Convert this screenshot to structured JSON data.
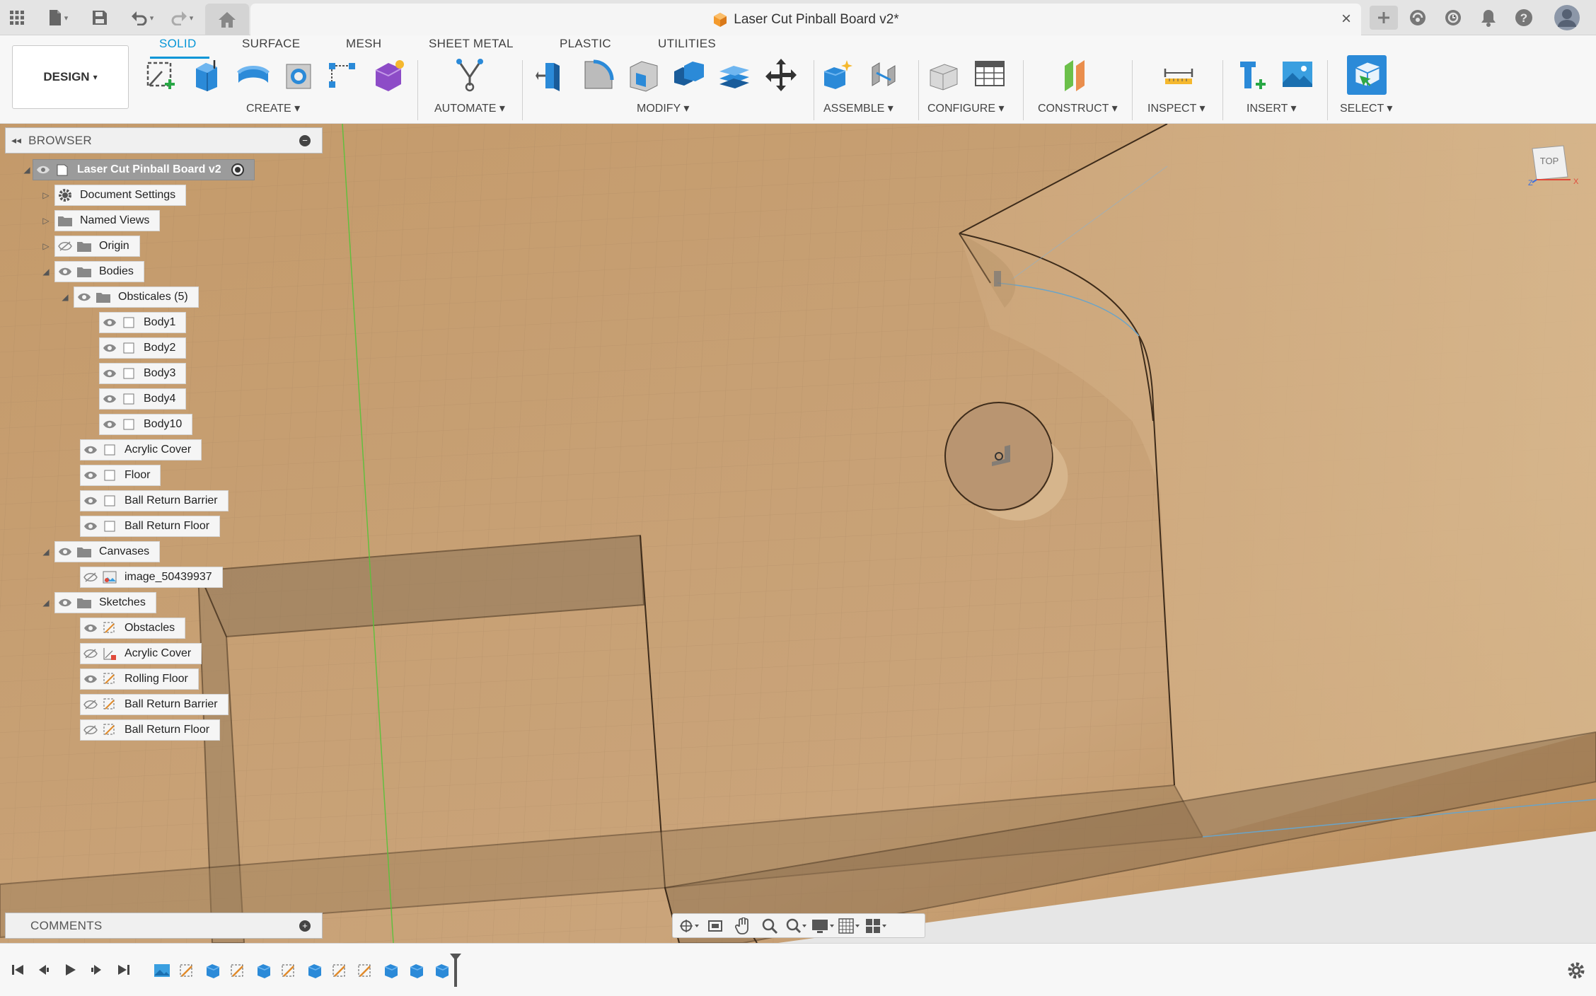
{
  "app": {
    "title": "Laser Cut Pinball Board v2*",
    "close_symbol": "×",
    "icons": [
      "apps-grid-icon",
      "file-icon",
      "save-icon",
      "undo-icon",
      "redo-icon",
      "home-icon",
      "new-tab-icon",
      "extensions-icon",
      "job-status-icon",
      "notification-icon",
      "help-icon",
      "user-avatar-icon"
    ]
  },
  "workspace": {
    "label": "DESIGN",
    "caret": "▾"
  },
  "tabs": [
    {
      "label": "SOLID",
      "active": true
    },
    {
      "label": "SURFACE"
    },
    {
      "label": "MESH"
    },
    {
      "label": "SHEET METAL"
    },
    {
      "label": "PLASTIC"
    },
    {
      "label": "UTILITIES"
    }
  ],
  "groups": {
    "create": "CREATE ▾",
    "automate": "AUTOMATE ▾",
    "modify": "MODIFY ▾",
    "assemble": "ASSEMBLE ▾",
    "configure": "CONFIGURE ▾",
    "construct": "CONSTRUCT ▾",
    "inspect": "INSPECT ▾",
    "insert": "INSERT ▾",
    "select": "SELECT ▾"
  },
  "browser": {
    "title": "BROWSER",
    "collapse": "−",
    "root": "Laser Cut Pinball Board v2",
    "nodes": {
      "doc_settings": "Document Settings",
      "named_views": "Named Views",
      "origin": "Origin",
      "bodies": "Bodies",
      "obstacles_folder": "Obsticales (5)",
      "body1": "Body1",
      "body2": "Body2",
      "body3": "Body3",
      "body4": "Body4",
      "body10": "Body10",
      "acrylic_cover": "Acrylic Cover",
      "floor": "Floor",
      "ball_return_barrier": "Ball Return Barrier",
      "ball_return_floor": "Ball Return Floor",
      "canvases": "Canvases",
      "image": "image_50439937",
      "sketches": "Sketches",
      "sk_obstacles": "Obstacles",
      "sk_acrylic_cover": "Acrylic Cover",
      "sk_rolling_floor": "Rolling Floor",
      "sk_ball_return_barrier": "Ball Return Barrier",
      "sk_ball_return_floor": "Ball Return Floor"
    }
  },
  "comments": {
    "title": "COMMENTS",
    "add": "+"
  },
  "viewcube": {
    "label": "TOP",
    "axis_z": "Z",
    "axis_x": "X"
  },
  "colors": {
    "accent": "#0696d7",
    "wood": "#c9a070"
  }
}
